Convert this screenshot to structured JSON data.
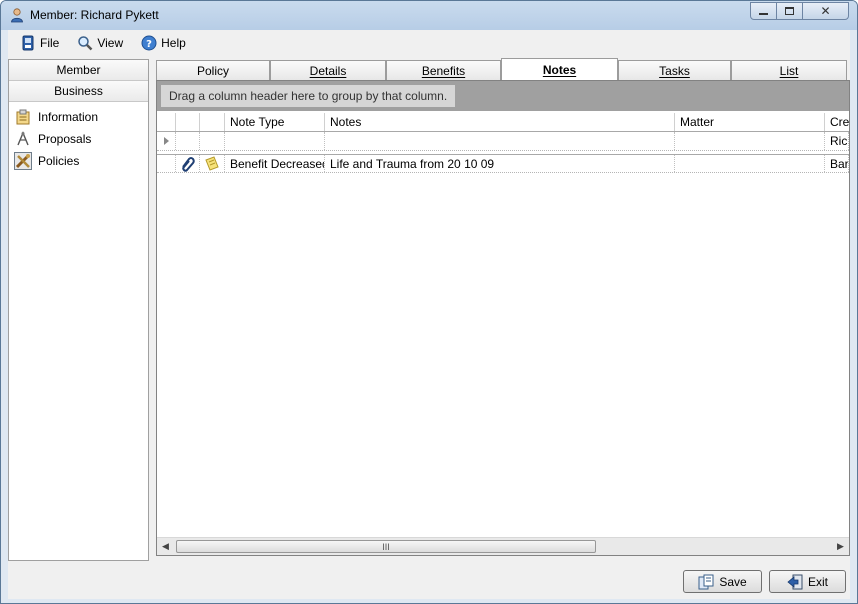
{
  "window": {
    "title": "Member: Richard Pykett",
    "controls": {
      "minimize": "▭",
      "maximize": "▢",
      "close": "✕"
    }
  },
  "menu": [
    {
      "label": "File",
      "icon": "file-icon"
    },
    {
      "label": "View",
      "icon": "view-icon"
    },
    {
      "label": "Help",
      "icon": "help-icon"
    }
  ],
  "nav": {
    "sections": [
      "Member",
      "Business"
    ],
    "items": [
      {
        "label": "Information",
        "icon": "information-icon"
      },
      {
        "label": "Proposals",
        "icon": "proposals-icon"
      },
      {
        "label": "Policies",
        "icon": "policies-icon",
        "selected": true
      }
    ]
  },
  "tabs": [
    {
      "label": "Policy"
    },
    {
      "label": "Details",
      "underline": "D"
    },
    {
      "label": "Benefits",
      "underline": "B"
    },
    {
      "label": "Notes",
      "underline": "N",
      "active": true
    },
    {
      "label": "Tasks",
      "underline": "T"
    },
    {
      "label": "List",
      "underline": "L"
    }
  ],
  "grid": {
    "group_hint": "Drag a column header here to group by that column.",
    "columns": [
      "",
      "",
      "",
      "Note Type",
      "Notes",
      "Matter",
      "Crea"
    ],
    "filter_row": {
      "creator": "Rich"
    },
    "rows": [
      {
        "note_type": "Benefit Decreased",
        "notes": "Life and Trauma from 20 10 09",
        "matter": "",
        "creator": "Barb"
      }
    ],
    "scroll_grip": "III"
  },
  "buttons": {
    "save": "Save",
    "exit": "Exit"
  }
}
